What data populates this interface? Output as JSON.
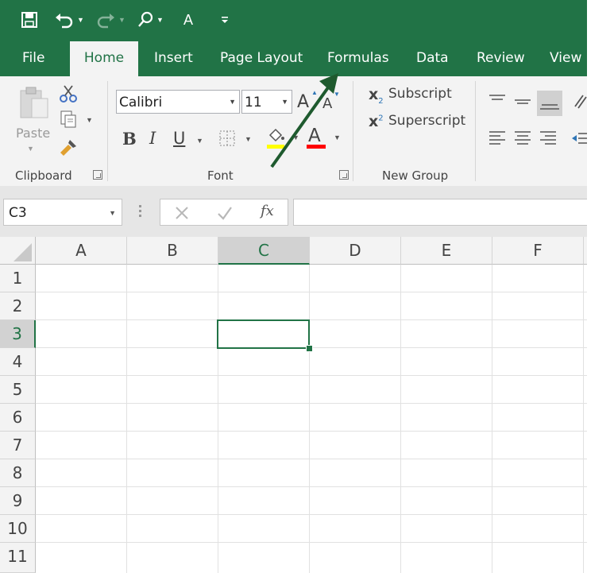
{
  "quick_access": {
    "font_letter": "A"
  },
  "tabs": [
    {
      "label": "File"
    },
    {
      "label": "Home"
    },
    {
      "label": "Insert"
    },
    {
      "label": "Page Layout"
    },
    {
      "label": "Formulas"
    },
    {
      "label": "Data"
    },
    {
      "label": "Review"
    },
    {
      "label": "View"
    }
  ],
  "ribbon": {
    "clipboard": {
      "paste_label": "Paste",
      "group_label": "Clipboard"
    },
    "font": {
      "font_name": "Calibri",
      "font_size": "11",
      "grow_font": "A",
      "shrink_font": "A",
      "bold": "B",
      "italic": "I",
      "underline": "U",
      "font_color_letter": "A",
      "group_label": "Font"
    },
    "new_group": {
      "subscript_label": "Subscript",
      "superscript_label": "Superscript",
      "subscript_glyph": "x",
      "subscript_digit": "2",
      "superscript_glyph": "x",
      "superscript_digit": "2",
      "group_label": "New Group"
    }
  },
  "formula_bar": {
    "name_box": "C3",
    "fx": "fx",
    "formula": ""
  },
  "sheet": {
    "columns": [
      "A",
      "B",
      "C",
      "D",
      "E",
      "F"
    ],
    "rows": [
      "1",
      "2",
      "3",
      "4",
      "5",
      "6",
      "7",
      "8",
      "9",
      "10",
      "11"
    ],
    "selected_column": "C",
    "selected_row": "3"
  },
  "colors": {
    "accent": "#217346",
    "arrow": "#1e5a2e",
    "highlight_yellow": "#ffff00",
    "font_red": "#ff0000"
  }
}
